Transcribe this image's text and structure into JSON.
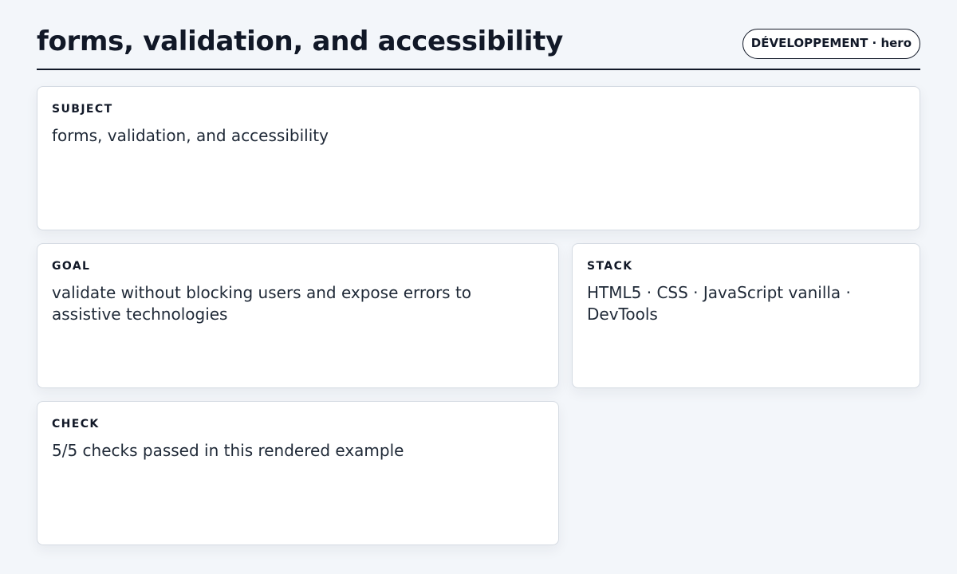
{
  "header": {
    "title": "forms, validation, and accessibility",
    "badge": "DÉVELOPPEMENT · hero"
  },
  "cards": {
    "subject": {
      "label": "SUBJECT",
      "value": "forms, validation, and accessibility"
    },
    "goal": {
      "label": "GOAL",
      "value": "validate without blocking users and expose errors to assistive technologies"
    },
    "stack": {
      "label": "STACK",
      "value": "HTML5 · CSS · JavaScript vanilla · DevTools"
    },
    "check": {
      "label": "CHECK",
      "value": "5/5 checks passed in this rendered example"
    }
  }
}
